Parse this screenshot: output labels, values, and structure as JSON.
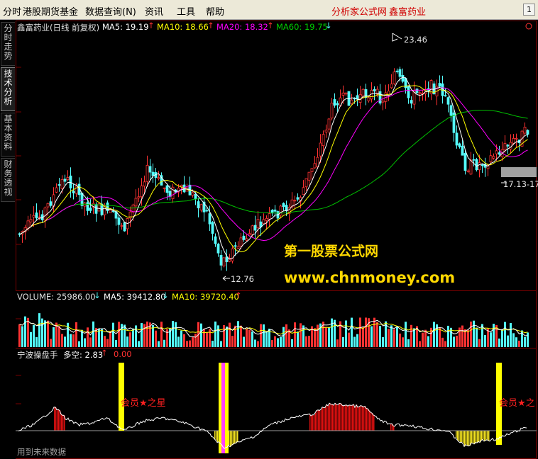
{
  "menu": {
    "items": [
      "分时",
      "港股期货基金",
      "数据查询(N)",
      "资讯",
      "工具",
      "帮助"
    ],
    "site_label": "分析家公式网",
    "stock_label": "鑫富药业",
    "window_button": "1"
  },
  "side_tabs": [
    "分时走势",
    "技术分析",
    "基本资料",
    "财务透视"
  ],
  "main_panel": {
    "stock_name": "鑫富药业(日线 前复权)",
    "ma5_label": "MA5: 19.19",
    "ma10_label": "MA10: 18.66",
    "ma20_label": "MA20: 18.32",
    "ma60_label": "MA60: 19.75",
    "high_label": "23.46",
    "low_label": "12.76",
    "range_label": "17.13-17",
    "watermark_cn": "第一股票公式网",
    "watermark_url": "www.chnmoney.com"
  },
  "volume_panel": {
    "volume_label": "VOLUME: 25986.00",
    "ma5_label": "MA5: 39412.80",
    "ma10_label": "MA10: 39720.40"
  },
  "indicator_panel": {
    "title": "宁波操盘手",
    "duokong_label": "多空: 2.83",
    "zero_label": "0.00",
    "star_label_1": "会员★之星",
    "star_label_2": "会员★之",
    "footer_note": "用到未来数据"
  },
  "colors": {
    "up": "#ff3232",
    "down": "#54fcfc",
    "ma5": "#ffffff",
    "ma10": "#ffff00",
    "ma20": "#ff00ff",
    "ma60": "#00c000",
    "menu_bg": "#ece9d8",
    "accent_red": "#d00000",
    "watermark": "#ffd800"
  }
}
